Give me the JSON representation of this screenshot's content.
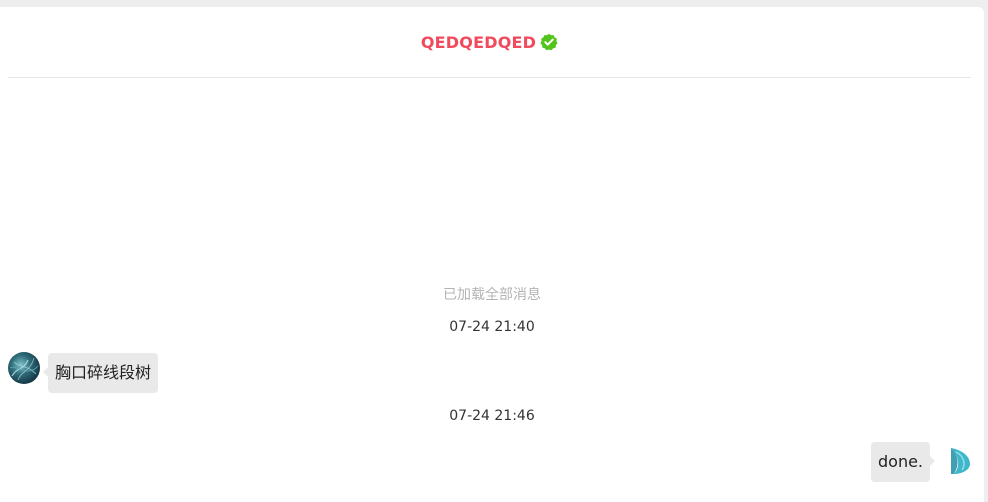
{
  "chat": {
    "title": "QEDQEDQED",
    "verified": true,
    "verified_icon": "verified-check-icon",
    "title_color": "#f04a5c",
    "notice": "已加载全部消息",
    "messages": [
      {
        "timestamp": "07-24 21:40",
        "side": "left",
        "text": "胸口碎线段树",
        "avatar": "user-avatar"
      },
      {
        "timestamp": "07-24 21:46",
        "side": "right",
        "text": "done.",
        "avatar": "self-avatar"
      }
    ]
  }
}
